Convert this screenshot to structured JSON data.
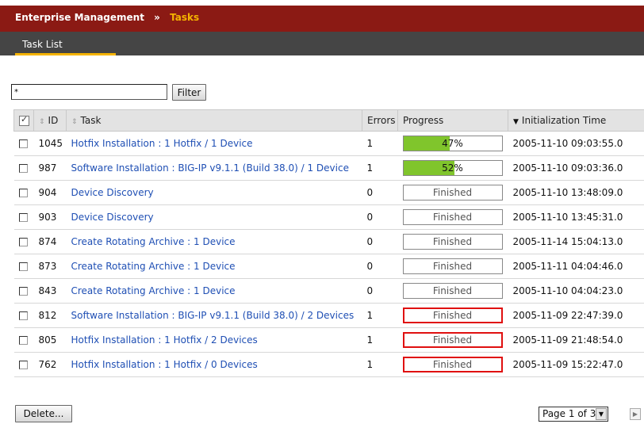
{
  "header": {
    "breadcrumb_root": "Enterprise Management",
    "breadcrumb_separator": "»",
    "breadcrumb_current": "Tasks"
  },
  "tabs": [
    {
      "label": "Task List"
    }
  ],
  "filter": {
    "value": "*",
    "button_label": "Filter"
  },
  "table": {
    "columns": {
      "id": "ID",
      "task": "Task",
      "errors": "Errors",
      "progress": "Progress",
      "init_time": "Initialization Time"
    },
    "rows": [
      {
        "id": "1045",
        "task": "Hotfix Installation : 1 Hotfix / 1 Device",
        "errors": "1",
        "progress_text": "47%",
        "progress_pct": 47,
        "progress_state": "running",
        "init_time": "2005-11-10 09:03:55.0"
      },
      {
        "id": "987",
        "task": "Software Installation : BIG-IP v9.1.1 (Build 38.0) / 1 Device",
        "errors": "1",
        "progress_text": "52%",
        "progress_pct": 52,
        "progress_state": "running",
        "init_time": "2005-11-10 09:03:36.0"
      },
      {
        "id": "904",
        "task": "Device Discovery",
        "errors": "0",
        "progress_text": "Finished",
        "progress_pct": 100,
        "progress_state": "finished",
        "init_time": "2005-11-10 13:48:09.0"
      },
      {
        "id": "903",
        "task": "Device Discovery",
        "errors": "0",
        "progress_text": "Finished",
        "progress_pct": 100,
        "progress_state": "finished",
        "init_time": "2005-11-10 13:45:31.0"
      },
      {
        "id": "874",
        "task": "Create Rotating Archive : 1 Device",
        "errors": "0",
        "progress_text": "Finished",
        "progress_pct": 100,
        "progress_state": "finished",
        "init_time": "2005-11-14 15:04:13.0"
      },
      {
        "id": "873",
        "task": "Create Rotating Archive : 1 Device",
        "errors": "0",
        "progress_text": "Finished",
        "progress_pct": 100,
        "progress_state": "finished",
        "init_time": "2005-11-11 04:04:46.0"
      },
      {
        "id": "843",
        "task": "Create Rotating Archive : 1 Device",
        "errors": "0",
        "progress_text": "Finished",
        "progress_pct": 100,
        "progress_state": "finished",
        "init_time": "2005-11-10 04:04:23.0"
      },
      {
        "id": "812",
        "task": "Software Installation : BIG-IP v9.1.1 (Build 38.0) / 2 Devices",
        "errors": "1",
        "progress_text": "Finished",
        "progress_pct": 100,
        "progress_state": "finished-error",
        "init_time": "2005-11-09 22:47:39.0"
      },
      {
        "id": "805",
        "task": "Hotfix Installation : 1 Hotfix / 2 Devices",
        "errors": "1",
        "progress_text": "Finished",
        "progress_pct": 100,
        "progress_state": "finished-error",
        "init_time": "2005-11-09 21:48:54.0"
      },
      {
        "id": "762",
        "task": "Hotfix Installation : 1 Hotfix / 0 Devices",
        "errors": "1",
        "progress_text": "Finished",
        "progress_pct": 100,
        "progress_state": "finished-error",
        "init_time": "2005-11-09 15:22:47.0"
      }
    ]
  },
  "footer": {
    "delete_label": "Delete...",
    "pager_label": "Page 1 of 3"
  },
  "icons": {
    "sort": "sort-updown-icon",
    "sort_desc": "sort-desc-icon",
    "dropdown": "chevron-down-icon",
    "next": "next-page-icon"
  },
  "colors": {
    "header_bg": "#8b1a14",
    "tabbar_bg": "#454545",
    "accent": "#f5b400",
    "link": "#1f4fb4",
    "progress_fill": "#80c52c",
    "error_border": "#e01010"
  }
}
